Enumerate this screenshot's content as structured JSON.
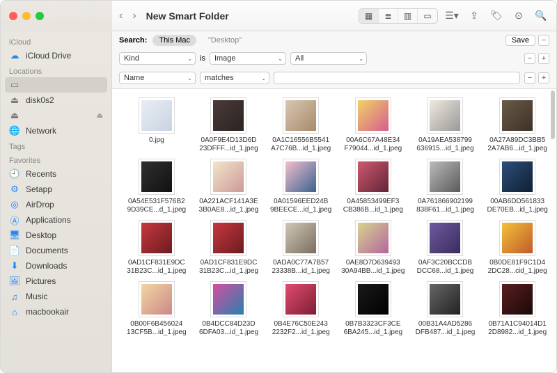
{
  "window_title": "New Smart Folder",
  "traffic_lights": [
    "close",
    "minimize",
    "zoom"
  ],
  "toolbar": {
    "back": "‹",
    "forward": "›",
    "view_icons": [
      "▦",
      "≣",
      "▥",
      "▭"
    ],
    "active_view": 0,
    "group_label": "☰▾",
    "share": "⇪",
    "tag": "🏷",
    "more": "⊙",
    "search": "🔍"
  },
  "sidebar": {
    "sections": [
      {
        "label": "iCloud",
        "items": [
          {
            "icon": "cloud",
            "color": "blue",
            "name": "iCloud Drive"
          }
        ]
      },
      {
        "label": "Locations",
        "items": [
          {
            "icon": "laptop",
            "color": "gray",
            "name": "",
            "selected": true
          },
          {
            "icon": "disk",
            "color": "gray",
            "name": "disk0s2"
          },
          {
            "icon": "disk",
            "color": "gray",
            "name": "",
            "eject": true
          },
          {
            "icon": "globe",
            "color": "gray",
            "name": "Network"
          }
        ]
      },
      {
        "label": "Tags",
        "items": []
      },
      {
        "label": "Favorites",
        "items": [
          {
            "icon": "clock",
            "color": "blue",
            "name": "Recents"
          },
          {
            "icon": "gear",
            "color": "blue",
            "name": "Setapp"
          },
          {
            "icon": "airdrop",
            "color": "blue",
            "name": "AirDrop"
          },
          {
            "icon": "apps",
            "color": "blue",
            "name": "Applications"
          },
          {
            "icon": "desktop",
            "color": "blue",
            "name": "Desktop"
          },
          {
            "icon": "doc",
            "color": "blue",
            "name": "Documents"
          },
          {
            "icon": "down",
            "color": "blue",
            "name": "Downloads"
          },
          {
            "icon": "pic",
            "color": "blue",
            "name": "Pictures"
          },
          {
            "icon": "music",
            "color": "blue",
            "name": "Music"
          },
          {
            "icon": "home",
            "color": "blue",
            "name": "macbookair"
          }
        ]
      }
    ]
  },
  "search": {
    "label": "Search:",
    "scopes": [
      "This Mac",
      "\"Desktop\""
    ],
    "active_scope": 0,
    "save_label": "Save",
    "rules": [
      {
        "attr": "Kind",
        "op": "is",
        "val1": "Image",
        "val2": "All"
      },
      {
        "attr": "Name",
        "op": "matches",
        "val1": ""
      }
    ]
  },
  "icon_glyphs": {
    "cloud": "☁",
    "laptop": "▭",
    "disk": "⏏",
    "globe": "🌐",
    "clock": "🕘",
    "gear": "⚙",
    "airdrop": "◎",
    "apps": "Ⓐ",
    "desktop": "🖥",
    "doc": "📄",
    "down": "⬇",
    "pic": "🖼",
    "music": "♫",
    "home": "⌂"
  },
  "thumb_palette": [
    "linear-gradient(135deg,#e9eef5,#c8d3e2)",
    "linear-gradient(135deg,#4a3b39,#2b2422)",
    "linear-gradient(135deg,#d8c7b2,#a78b6b)",
    "linear-gradient(135deg,#f0d267,#d65e8d)",
    "linear-gradient(135deg,#efe9df,#999)",
    "linear-gradient(135deg,#6a5a48,#3c3228)",
    "linear-gradient(135deg,#303030,#111)",
    "linear-gradient(135deg,#f2e6c8,#c99)",
    "linear-gradient(135deg,#f2bfcf,#3a628f)",
    "linear-gradient(135deg,#ce5a6f,#632437)",
    "linear-gradient(135deg,#bbb,#5a5a5a)",
    "linear-gradient(135deg,#2e4f7a,#0f1f33)",
    "linear-gradient(135deg,#c6393f,#6c1b1f)",
    "linear-gradient(135deg,#c6393f,#6c1b1f)",
    "linear-gradient(135deg,#d0c7b8,#7a6f5e)",
    "linear-gradient(135deg,#d7d48e,#b5669d)",
    "linear-gradient(135deg,#6e5aa0,#3a2c5c)",
    "linear-gradient(135deg,#f4c23a,#c05a2b)",
    "linear-gradient(135deg,#f2d7a3,#c88)",
    "linear-gradient(135deg,#d44fa0,#2b7fae)",
    "linear-gradient(135deg,#e24b6e,#7c1f35)",
    "linear-gradient(135deg,#1a1a1a,#000)",
    "linear-gradient(135deg,#666,#222)",
    "linear-gradient(135deg,#5a1f1f,#1a0808)"
  ],
  "files": [
    {
      "name_l1": "0.jpg",
      "name_l2": ""
    },
    {
      "name_l1": "0A0F9E4D13D6D",
      "name_l2": "23DFFF...id_1.jpeg"
    },
    {
      "name_l1": "0A1C16556B5541",
      "name_l2": "A7C76B...id_1.jpeg"
    },
    {
      "name_l1": "00A6C67A48E34",
      "name_l2": "F79044...id_1.jpeg"
    },
    {
      "name_l1": "0A19AEA538799",
      "name_l2": "636915...id_1.jpeg"
    },
    {
      "name_l1": "0A27A89DC3BB5",
      "name_l2": "2A7AB6...id_1.jpeg"
    },
    {
      "name_l1": "0A54E531F576B2",
      "name_l2": "9D39CE...d_1.jpeg"
    },
    {
      "name_l1": "0A221ACF141A3E",
      "name_l2": "3B0AE8...id_1.jpeg"
    },
    {
      "name_l1": "0A01596EED24B",
      "name_l2": "9BEECE...id_1.jpeg"
    },
    {
      "name_l1": "0A45853499EF3",
      "name_l2": "CB386B...id_1.jpeg"
    },
    {
      "name_l1": "0A761866902199",
      "name_l2": "838F61...id_1.jpeg"
    },
    {
      "name_l1": "00AB6DD561833",
      "name_l2": "DE70EB...id_1.jpeg"
    },
    {
      "name_l1": "0AD1CF831E9DC",
      "name_l2": "31B23C...id_1.jpeg"
    },
    {
      "name_l1": "0AD1CF831E9DC",
      "name_l2": "31B23C...id_1.jpeg"
    },
    {
      "name_l1": "0ADA0C77A7B57",
      "name_l2": "23338B...id_1.jpeg"
    },
    {
      "name_l1": "0AE8D7D639493",
      "name_l2": "30A94BB...id_1.jpeg"
    },
    {
      "name_l1": "0AF3C20BCCDB",
      "name_l2": "DCC68...id_1.jpeg"
    },
    {
      "name_l1": "0B0DE81F9C1D4",
      "name_l2": "2DC28...cid_1.jpeg"
    },
    {
      "name_l1": "0B00F6B456024",
      "name_l2": "13CF5B...id_1.jpeg"
    },
    {
      "name_l1": "0B4DCC84D23D",
      "name_l2": "6DFA03...id_1.jpeg"
    },
    {
      "name_l1": "0B4E76C50E243",
      "name_l2": "2232F2...id_1.jpeg"
    },
    {
      "name_l1": "0B7B3323CF3CE",
      "name_l2": "6BA245...id_1.jpeg"
    },
    {
      "name_l1": "00B31A4AD5286",
      "name_l2": "DFB487...id_1.jpeg"
    },
    {
      "name_l1": "0B71A1C94014D1",
      "name_l2": "2D8982...id_1.jpeg"
    }
  ]
}
